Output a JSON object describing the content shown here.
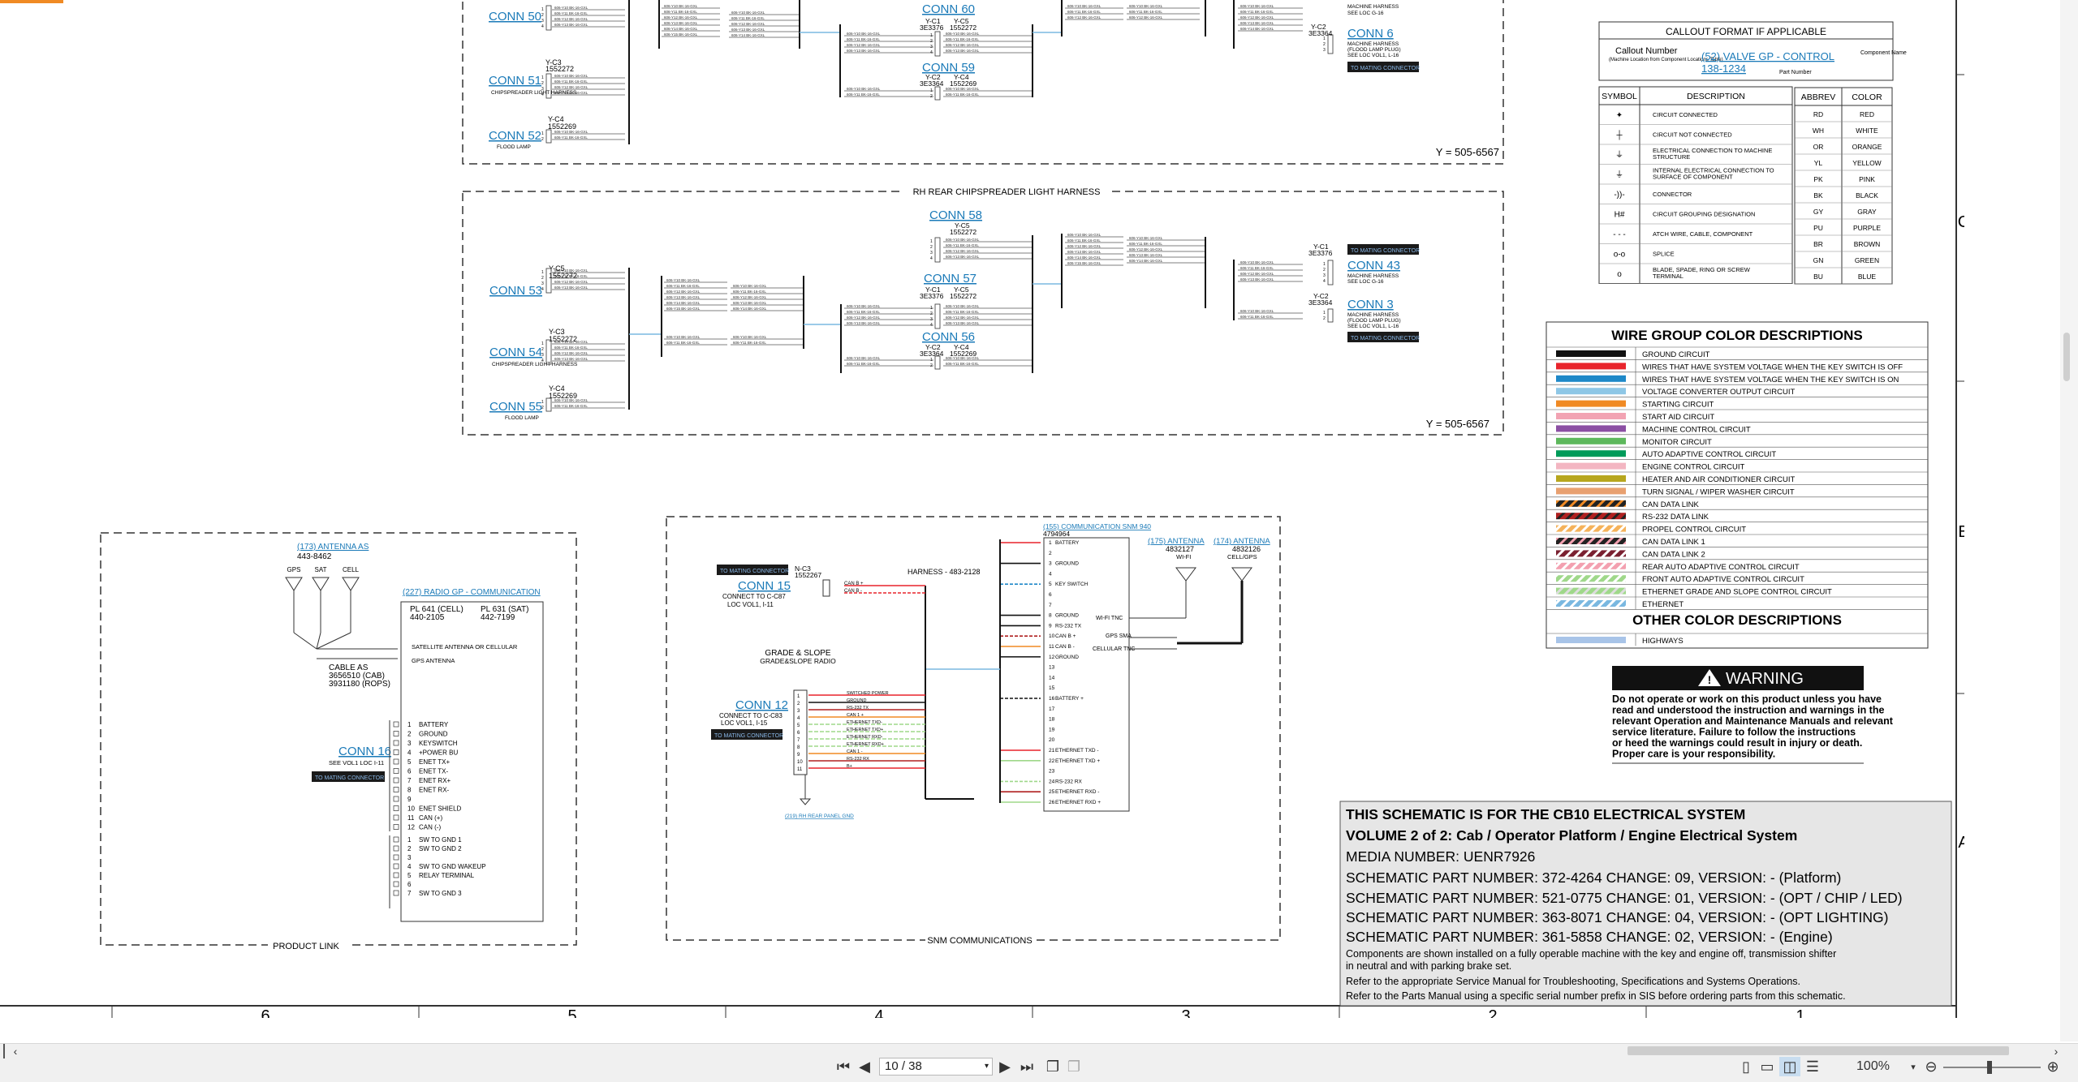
{
  "schematic": {
    "zone_columns": [
      "6",
      "5",
      "4",
      "3",
      "2",
      "1"
    ],
    "zone_rows": [
      "C",
      "B",
      "A"
    ],
    "top_harness": {
      "conns_left": [
        {
          "label": "CONN 50",
          "id": ""
        },
        {
          "label": "CONN 51",
          "id": "1552272",
          "sub": "CHIPSPREADER LIGHT HARNESS",
          "yc": "Y-C3"
        },
        {
          "label": "CONN 52",
          "id": "1552269",
          "sub": "FLOOD LAMP",
          "yc": "Y-C4"
        }
      ],
      "conns_mid": [
        {
          "label": "CONN 60",
          "yc1": "Y-C1",
          "id1": "3E3376",
          "yc2": "Y-C5",
          "id2": "1552272"
        },
        {
          "label": "CONN 59",
          "yc1": "Y-C2",
          "id1": "3E3364",
          "yc2": "Y-C4",
          "id2": "1552269"
        }
      ],
      "conn_right": {
        "label": "CONN 6",
        "id": "3E3364",
        "yc": "Y-C2",
        "note1": "MACHINE HARNESS",
        "note2": "(FLOOD LAMP PLUG)",
        "note3": "SEE LOC VOL1, L-16",
        "top_note1": "MACHINE HARNESS",
        "top_note2": "SEE LOC G-16"
      },
      "y_code": "Y = 505-6567"
    },
    "rh_harness": {
      "title": "RH REAR CHIPSPREADER LIGHT HARNESS",
      "conns_left": [
        {
          "label": "CONN 53",
          "yc": "Y-C5",
          "id": "1552272"
        },
        {
          "label": "CONN 54",
          "yc": "Y-C3",
          "id": "1552272",
          "sub": "CHIPSPREADER LIGHT HARNESS"
        },
        {
          "label": "CONN 55",
          "yc": "Y-C4",
          "id": "1552269",
          "sub": "FLOOD LAMP"
        }
      ],
      "conns_mid": [
        {
          "label": "CONN 58",
          "yc": "Y-C5",
          "id": "1552272"
        },
        {
          "label": "CONN 57",
          "yc1": "Y-C1",
          "id1": "3E3376",
          "yc2": "Y-C5",
          "id2": "1552272"
        },
        {
          "label": "CONN 56",
          "yc1": "Y-C2",
          "id1": "3E3364",
          "yc2": "Y-C4",
          "id2": "1552269"
        }
      ],
      "conns_right": [
        {
          "label": "CONN 43",
          "yc": "Y-C1",
          "id": "3E3376",
          "note1": "MACHINE HARNESS",
          "note2": "SEE LOC G-16"
        },
        {
          "label": "CONN 3",
          "yc": "Y-C2",
          "id": "3E3364",
          "note1": "MACHINE HARNESS",
          "note2": "(FLOOD LAMP PLUG)",
          "note3": "SEE LOC VOL1, L-16"
        }
      ],
      "y_code": "Y = 505-6567",
      "mating_label": "TO MATING CONNECTOR"
    },
    "product_link": {
      "title": "PRODUCT LINK",
      "antenna_label": "(173) ANTENNA AS",
      "antenna_id": "443-8462",
      "antenna_types": [
        "GPS",
        "SAT",
        "CELL"
      ],
      "radio_label": "(227) RADIO GP - COMMUNICATION",
      "pl641": "PL 641 (CELL)",
      "pl641_id": "440-2105",
      "pl631": "PL 631 (SAT)",
      "pl631_id": "442-7199",
      "sat_ant_label": "SATELLITE ANTENNA OR CELLULAR",
      "gps_ant_label": "GPS ANTENNA",
      "cable_label": "CABLE AS",
      "cable_id1": "3656510 (CAB)",
      "cable_id2": "3931180 (ROPS)",
      "conn_label": "CONN 16",
      "conn_note": "SEE VOL1 LOC I-11",
      "mating": "TO MATING CONNECTOR",
      "pins": [
        "BATTERY",
        "GROUND",
        "KEYSWITCH",
        "+POWER BU",
        "ENET TX+",
        "ENET TX-",
        "ENET RX+",
        "ENET RX-",
        "",
        "ENET SHIELD",
        "CAN (+)",
        "CAN (-)"
      ],
      "pins2": [
        "SW TO GND 1",
        "SW TO GND 2",
        "",
        "SW TO GND WAKEUP",
        "RELAY TERMINAL",
        "",
        "SW TO GND 3"
      ]
    },
    "snm": {
      "title": "SNM COMMUNICATIONS",
      "mating": "TO MATING CONNECTOR",
      "conn15": "CONN 15",
      "conn15_note1": "CONNECT TO C-C87",
      "conn15_note2": "LOC VOL1, I-11",
      "nc3": "N-C3",
      "nc3_id": "1552267",
      "harness": "HARNESS - 483-2128",
      "grade_slope1": "GRADE & SLOPE",
      "grade_slope2": "GRADE&SLOPE RADIO",
      "conn12": "CONN 12",
      "conn12_note1": "CONNECT TO C-C83",
      "conn12_note2": "LOC VOL1, I-15",
      "snm_label": "(155) COMMUNICATION SNM 940",
      "snm_id": "4794964",
      "snm_pins": [
        "BATTERY",
        "",
        "GROUND",
        "",
        "KEY SWITCH",
        "",
        "",
        "GROUND",
        "RS-232 TX",
        "CAN B +",
        "CAN B -",
        "GROUND",
        "",
        "",
        "",
        "BATTERY +",
        "",
        "",
        "",
        "",
        "ETHERNET TXD -",
        "ETHERNET TXD +",
        "",
        "RS-232 RX",
        "ETHERNET RXD -",
        "ETHERNET RXD +"
      ],
      "ant175": "(175) ANTENNA",
      "ant175_id": "4832127",
      "ant175_type": "WI-FI",
      "ant174": "(174) ANTENNA",
      "ant174_id": "4832126",
      "ant174_type": "CELL/GPS",
      "wifi_tnc": "WI-FI TNC",
      "gps_sma": "GPS SMA",
      "cell_tnc": "CELLULAR TNC",
      "conn12_pins": [
        "SWITCHED POWER",
        "GROUND",
        "RS-232 TX",
        "CAN 1 +",
        "ETHERNET TXD-",
        "ETHERNET TXD+",
        "ETHERNET RXD-",
        "ETHERNET RXD+",
        "CAN 1 -",
        "RS-232 RX",
        "B+"
      ],
      "gnd": "(219) RH REAR PANEL GND"
    },
    "callout": {
      "title": "CALLOUT FORMAT IF APPLICABLE",
      "number_label": "Callout Number",
      "number_sub": "(Machine Location from Component Locations Table)",
      "example": "(52) VALVE GP - CONTROL",
      "part": "138-1234",
      "component_name": "Component Name",
      "part_number": "Part Number"
    },
    "symbols": {
      "headers": [
        "SYMBOL",
        "DESCRIPTION"
      ],
      "rows": [
        "CIRCUIT CONNECTED",
        "CIRCUIT NOT CONNECTED",
        "ELECTRICAL CONNECTION TO MACHINE STRUCTURE",
        "INTERNAL ELECTRICAL CONNECTION TO SURFACE OF COMPONENT",
        "CONNECTOR",
        "CIRCUIT GROUPING DESIGNATION",
        "ATCH WIRE, CABLE, COMPONENT",
        "SPLICE",
        "BLADE, SPADE, RING OR SCREW TERMINAL"
      ]
    },
    "colors": {
      "headers": [
        "ABBREV",
        "COLOR"
      ],
      "rows": [
        [
          "RD",
          "RED"
        ],
        [
          "WH",
          "WHITE"
        ],
        [
          "OR",
          "ORANGE"
        ],
        [
          "YL",
          "YELLOW"
        ],
        [
          "PK",
          "PINK"
        ],
        [
          "BK",
          "BLACK"
        ],
        [
          "GY",
          "GRAY"
        ],
        [
          "PU",
          "PURPLE"
        ],
        [
          "BR",
          "BROWN"
        ],
        [
          "GN",
          "GREEN"
        ],
        [
          "BU",
          "BLUE"
        ]
      ]
    },
    "wire_groups": {
      "title": "WIRE GROUP COLOR DESCRIPTIONS",
      "rows": [
        {
          "label": "GROUND CIRCUIT",
          "color": "#111111",
          "stripe": ""
        },
        {
          "label": "WIRES THAT HAVE SYSTEM VOLTAGE WHEN THE KEY SWITCH IS OFF",
          "color": "#e8242c",
          "stripe": ""
        },
        {
          "label": "WIRES THAT HAVE SYSTEM VOLTAGE WHEN THE KEY SWITCH IS ON",
          "color": "#1e88c8",
          "stripe": ""
        },
        {
          "label": "VOLTAGE CONVERTER OUTPUT CIRCUIT",
          "color": "#8ec7e6",
          "stripe": ""
        },
        {
          "label": "STARTING CIRCUIT",
          "color": "#f08a24",
          "stripe": ""
        },
        {
          "label": "START AID CIRCUIT",
          "color": "#f2a3b3",
          "stripe": ""
        },
        {
          "label": "MACHINE CONTROL CIRCUIT",
          "color": "#8b4fa3",
          "stripe": ""
        },
        {
          "label": "MONITOR CIRCUIT",
          "color": "#5db85c",
          "stripe": ""
        },
        {
          "label": "AUTO ADAPTIVE CONTROL CIRCUIT",
          "color": "#009b5a",
          "stripe": ""
        },
        {
          "label": "ENGINE CONTROL CIRCUIT",
          "color": "#f3b6c2",
          "stripe": ""
        },
        {
          "label": "HEATER AND AIR CONDITIONER CIRCUIT",
          "color": "#b7a61e",
          "stripe": ""
        },
        {
          "label": "TURN SIGNAL / WIPER WASHER CIRCUIT",
          "color": "#e8a070",
          "stripe": ""
        },
        {
          "label": "CAN DATA LINK",
          "color": "#222222",
          "stripe": "#f08a24"
        },
        {
          "label": "RS-232 DATA LINK",
          "color": "#b02020",
          "stripe": "#222222"
        },
        {
          "label": "PROPEL CONTROL CIRCUIT",
          "color": "#f5b25a",
          "stripe": "#ffffff"
        },
        {
          "label": "CAN DATA LINK 1",
          "color": "#222222",
          "stripe": "#f3a0b0"
        },
        {
          "label": "CAN DATA LINK 2",
          "color": "#7a2030",
          "stripe": "#ffffff"
        },
        {
          "label": "REAR AUTO ADAPTIVE CONTROL CIRCUIT",
          "color": "#f3a0b0",
          "stripe": "#ffffff"
        },
        {
          "label": "FRONT AUTO ADAPTIVE CONTROL CIRCUIT",
          "color": "#9fd88a",
          "stripe": "#ffffff"
        },
        {
          "label": "ETHERNET GRADE AND SLOPE CONTROL CIRCUIT",
          "color": "#9fd88a",
          "stripe": "#dddddd"
        },
        {
          "label": "ETHERNET",
          "color": "#7ab8e0",
          "stripe": "#ffffff"
        }
      ],
      "other_title": "OTHER COLOR DESCRIPTIONS",
      "other_rows": [
        {
          "label": "HIGHWAYS",
          "color": "#a8c4e8"
        }
      ]
    },
    "warning": {
      "title": "WARNING",
      "text": "Do not operate or work on this product unless you have read and understood the instruction and warnings in the relevant Operation and Maintenance Manuals and relevant service literature. Failure to follow the instructions or heed the warnings could result in injury or death. Proper care is your responsibility."
    },
    "info": {
      "line1": "THIS SCHEMATIC IS FOR THE CB10 ELECTRICAL SYSTEM",
      "line2": "VOLUME 2 of 2: Cab / Operator Platform / Engine Electrical System",
      "line3": "MEDIA NUMBER: UENR7926",
      "line4": "SCHEMATIC PART NUMBER: 372-4264 CHANGE: 09, VERSION: - (Platform)",
      "line5": "SCHEMATIC PART NUMBER: 521-0775 CHANGE: 01, VERSION: - (OPT / CHIP / LED)",
      "line6": "SCHEMATIC PART NUMBER: 363-8071 CHANGE: 04, VERSION: - (OPT LIGHTING)",
      "line7": "SCHEMATIC PART NUMBER: 361-5858 CHANGE: 02, VERSION: - (Engine)",
      "note1": "Components are shown installed on a fully operable machine with the key and engine off, transmission shifter",
      "note2": "in neutral and with parking brake set.",
      "note3": "Refer to the appropriate Service Manual for Troubleshooting, Specifications and Systems Operations.",
      "note4": "Refer to the Parts Manual using a specific serial number prefix in SIS before ordering parts from this schematic."
    }
  },
  "toolbar": {
    "page_value": "10 / 38",
    "zoom": "100%"
  }
}
